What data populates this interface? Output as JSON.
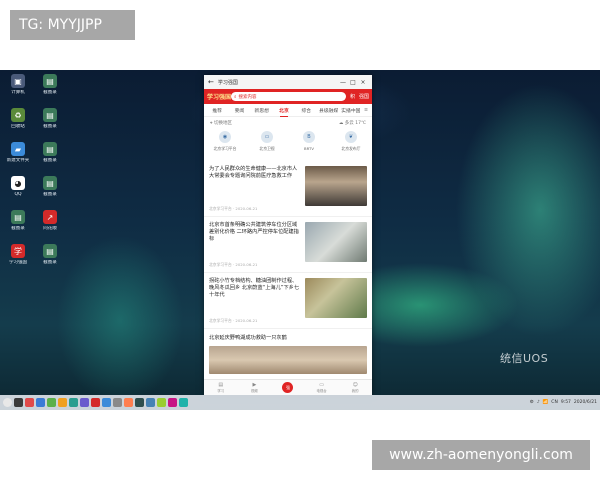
{
  "badge_top": "TG: MYYJJPP",
  "watermark_bottom": "www.zh-aomenyongli.com",
  "desktop": {
    "os_logo": "统信UOS",
    "icons": [
      {
        "label": "计算机",
        "icon": "computer-icon",
        "color": "#4a5a7a"
      },
      {
        "label": "截图录\n-6.png",
        "icon": "image-file-icon",
        "color": "#3c7a5a"
      },
      {
        "label": "回收站",
        "icon": "trash-icon",
        "color": "#5a8a3a"
      },
      {
        "label": "截图录\n-2.png",
        "icon": "image-file-icon",
        "color": "#3c7a5a"
      },
      {
        "label": "新建文件夹",
        "icon": "folder-icon",
        "color": "#3b8bd9"
      },
      {
        "label": "截图录\n-3.png",
        "icon": "image-file-icon",
        "color": "#3c7a5a"
      },
      {
        "label": "QQ",
        "icon": "qq-icon",
        "color": "#ffffff"
      },
      {
        "label": "截图录\n-7.png",
        "icon": "image-file-icon",
        "color": "#3c7a5a"
      },
      {
        "label": "截图录\n-5.png",
        "icon": "image-file-icon",
        "color": "#3c7a5a"
      },
      {
        "label": "同花顺",
        "icon": "stock-app-icon",
        "color": "#d42a2a"
      },
      {
        "label": "学习强国",
        "icon": "xuexi-app-icon",
        "color": "#d42a2a"
      },
      {
        "label": "截图录\n-4.png",
        "icon": "image-file-icon",
        "color": "#3c7a5a"
      }
    ]
  },
  "window": {
    "title": "学习强国",
    "controls": [
      "—",
      "□",
      "×"
    ],
    "app_logo": "学习强国",
    "search_placeholder": "搜索内容",
    "header_icons": [
      "积",
      "强国"
    ],
    "tabs": [
      "推荐",
      "要闻",
      "新思想",
      "北京",
      "综合",
      "县级融媒",
      "实播中国"
    ],
    "active_tab_index": 3,
    "menu_icon": "≡",
    "location": "切换地区",
    "weather": "多云 17℃",
    "channels": [
      {
        "label": "北京学习平台",
        "icon": "globe-icon"
      },
      {
        "label": "北京卫视",
        "icon": "tv-icon"
      },
      {
        "label": "BRTV",
        "icon": "brtv-icon"
      },
      {
        "label": "北京发布厅",
        "icon": "leaf-icon"
      }
    ],
    "articles": [
      {
        "title": "为了人民群众的生命健康——北京市人大常委会专题询问院前医疗急救工作",
        "meta": "北京学习平台 · 2020-06-21"
      },
      {
        "title": "北京市首条明确公共建筑停车位分区域差别化价格 二环路内严控停车位配建指标",
        "meta": "北京学习平台 · 2020-06-21"
      },
      {
        "title": "拐砣小竹专档结构、糖油团制作过程、晚风冬瓜回乡 北京蔚蓝“上海儿”下乡七十年代",
        "meta": "北京学习平台 · 2020-06-21"
      }
    ],
    "wide_article": {
      "title": "北京延庆野鸭湖成功救助一只灰鹤"
    },
    "bottom_nav": [
      {
        "label": "学习",
        "icon": "book-icon"
      },
      {
        "label": "视频",
        "icon": "video-icon"
      },
      {
        "label": "强",
        "icon": "center-icon"
      },
      {
        "label": "电视台",
        "icon": "tv-icon"
      },
      {
        "label": "我的",
        "icon": "user-icon"
      }
    ]
  },
  "taskbar": {
    "apps": [
      "#3b3b3b",
      "#e04a4a",
      "#3a7bd5",
      "#5ab04a",
      "#f0a020",
      "#2a9d8f",
      "#6a5acd",
      "#d42a2a",
      "#3b8bd9",
      "#8a8a8a",
      "#ff7f50",
      "#2f4f4f",
      "#4682b4",
      "#9acd32",
      "#c71585",
      "#20b2aa"
    ],
    "tray": [
      "⚙",
      "♪",
      "📶",
      "CN"
    ],
    "clock": "9:57",
    "date": "2020/6/21"
  }
}
